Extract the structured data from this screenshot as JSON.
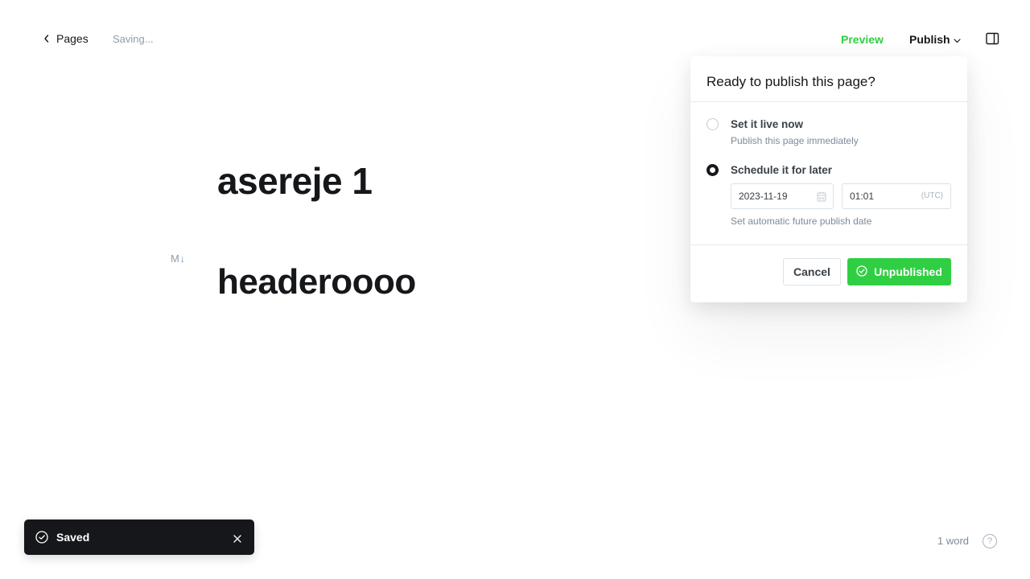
{
  "header": {
    "back_label": "Pages",
    "status": "Saving...",
    "preview_label": "Preview",
    "publish_label": "Publish"
  },
  "editor": {
    "title": "asereje 1",
    "markdown_badge": "M↓",
    "heading": "headeroooo"
  },
  "publish_menu": {
    "title": "Ready to publish this page?",
    "options": [
      {
        "label": "Set it live now",
        "description": "Publish this page immediately",
        "selected": false
      },
      {
        "label": "Schedule it for later",
        "description": "Set automatic future publish date",
        "selected": true
      }
    ],
    "date_value": "2023-11-19",
    "time_value": "01:01",
    "timezone": "(UTC)",
    "cancel_label": "Cancel",
    "submit_label": "Unpublished"
  },
  "toast": {
    "message": "Saved"
  },
  "footer": {
    "word_count": "1 word",
    "help_label": "?"
  },
  "colors": {
    "accent_green": "#30cf43",
    "dark": "#15171a",
    "muted": "#7c8b9a"
  }
}
